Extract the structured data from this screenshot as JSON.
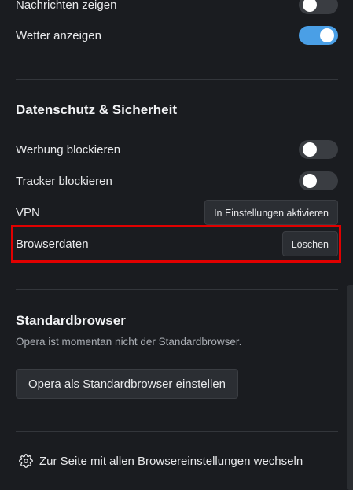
{
  "news": {
    "label": "Nachrichten zeigen",
    "enabled": false
  },
  "weather": {
    "label": "Wetter anzeigen",
    "enabled": true
  },
  "privacy": {
    "title": "Datenschutz & Sicherheit",
    "ads": {
      "label": "Werbung blockieren",
      "enabled": false
    },
    "trackers": {
      "label": "Tracker blockieren",
      "enabled": false
    },
    "vpn": {
      "label": "VPN",
      "button": "In Einstellungen aktivieren"
    },
    "browserdata": {
      "label": "Browserdaten",
      "button": "Löschen"
    }
  },
  "default_browser": {
    "title": "Standardbrowser",
    "status": "Opera ist momentan nicht der Standardbrowser.",
    "button": "Opera als Standardbrowser einstellen"
  },
  "all_settings_link": {
    "label": "Zur Seite mit allen Browsereinstellungen wechseln",
    "icon": "gear-icon"
  },
  "colors": {
    "accent": "#4a9fe6",
    "highlight": "#e00000",
    "background": "#1a1c20"
  }
}
